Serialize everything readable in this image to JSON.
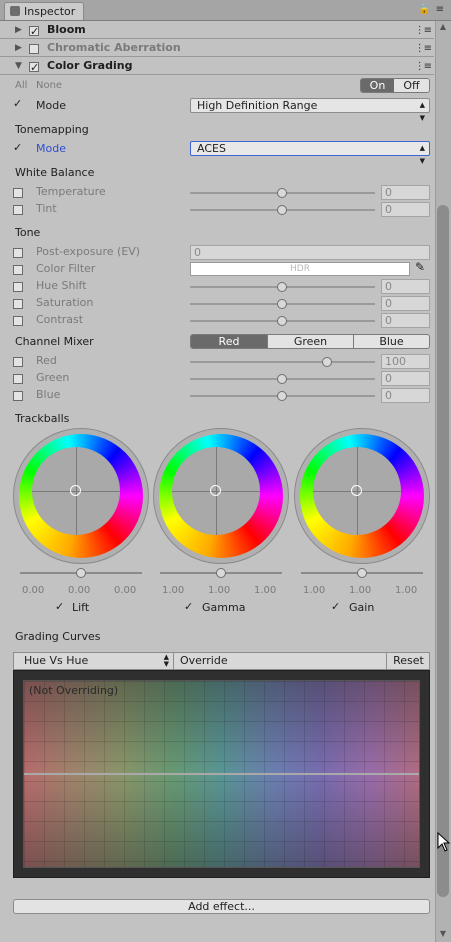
{
  "window": {
    "tab_title": "Inspector",
    "tab_tools": "🔒 ≡"
  },
  "effects": [
    {
      "name": "Bloom",
      "enabled": true,
      "expanded": false
    },
    {
      "name": "Chromatic Aberration",
      "enabled": false,
      "expanded": false
    },
    {
      "name": "Color Grading",
      "enabled": true,
      "expanded": true
    }
  ],
  "color_grading": {
    "all_label": "All",
    "none_label": "None",
    "toggle_on": "On",
    "toggle_off": "Off",
    "mode_label": "Mode",
    "mode_value": "High Definition Range",
    "tonemapping": {
      "header": "Tonemapping",
      "mode_label": "Mode",
      "mode_value": "ACES"
    },
    "white_balance": {
      "header": "White Balance",
      "temperature_label": "Temperature",
      "temperature_value": "0",
      "tint_label": "Tint",
      "tint_value": "0"
    },
    "tone": {
      "header": "Tone",
      "post_exposure_label": "Post-exposure (EV)",
      "post_exposure_value": "0",
      "color_filter_label": "Color Filter",
      "color_filter_value": "HDR",
      "hue_shift_label": "Hue Shift",
      "hue_shift_value": "0",
      "saturation_label": "Saturation",
      "saturation_value": "0",
      "contrast_label": "Contrast",
      "contrast_value": "0"
    },
    "channel_mixer": {
      "header": "Channel Mixer",
      "tabs": [
        "Red",
        "Green",
        "Blue"
      ],
      "selected_tab": "Red",
      "red_label": "Red",
      "red_value": "100",
      "green_label": "Green",
      "green_value": "0",
      "blue_label": "Blue",
      "blue_value": "0"
    },
    "trackballs": {
      "header": "Trackballs",
      "wheels": [
        {
          "label": "Lift",
          "values": [
            "0.00",
            "0.00",
            "0.00"
          ],
          "checked": true
        },
        {
          "label": "Gamma",
          "values": [
            "1.00",
            "1.00",
            "1.00"
          ],
          "checked": true
        },
        {
          "label": "Gain",
          "values": [
            "1.00",
            "1.00",
            "1.00"
          ],
          "checked": true
        }
      ]
    },
    "grading_curves": {
      "header": "Grading Curves",
      "curve_select": "Hue Vs Hue",
      "override_label": "Override",
      "reset_label": "Reset",
      "status": "(Not Overriding)"
    }
  },
  "add_effect_label": "Add effect...",
  "colors": {
    "focus_border": "#3d66d4",
    "mode_label_active": "#2f4fd0",
    "toggle_selected": "#6a6a6a"
  }
}
